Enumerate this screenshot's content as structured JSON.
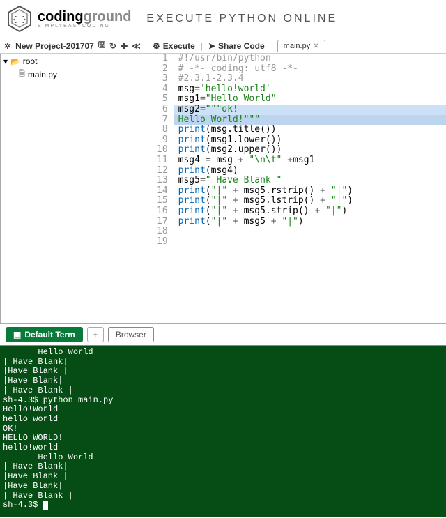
{
  "header": {
    "brand_main_a": "coding",
    "brand_main_b": "ground",
    "brand_sub": "SIMPLYEASYCODING",
    "title": "EXECUTE PYTHON ONLINE"
  },
  "project_toolbar": {
    "name": "New Project-201707"
  },
  "tree": {
    "root": "root",
    "file": "main.py"
  },
  "editor": {
    "execute": "Execute",
    "share": "Share Code",
    "tab": "main.py",
    "lines": [
      {
        "n": "1",
        "seg": [
          {
            "cls": "c-com",
            "t": "#!/usr/bin/python"
          }
        ]
      },
      {
        "n": "2",
        "seg": [
          {
            "cls": "c-com",
            "t": "# -*- coding: utf8 -*-"
          }
        ]
      },
      {
        "n": "3",
        "seg": [
          {
            "cls": "c-com",
            "t": "#2.3.1-2.3.4"
          }
        ]
      },
      {
        "n": "4",
        "seg": [
          {
            "cls": "",
            "t": "msg"
          },
          {
            "cls": "c-op",
            "t": "="
          },
          {
            "cls": "c-str",
            "t": "'hello!world'"
          }
        ]
      },
      {
        "n": "5",
        "seg": [
          {
            "cls": "",
            "t": "msg1"
          },
          {
            "cls": "c-op",
            "t": "="
          },
          {
            "cls": "c-str",
            "t": "\"Hello World\""
          }
        ]
      },
      {
        "n": "6",
        "hl": "hl",
        "seg": [
          {
            "cls": "",
            "t": "msg2"
          },
          {
            "cls": "c-op",
            "t": "="
          },
          {
            "cls": "c-str",
            "t": "\"\"\"ok!"
          }
        ]
      },
      {
        "n": "7",
        "hl": "hl-strong",
        "seg": [
          {
            "cls": "c-str",
            "t": "Hello World!\"\"\""
          }
        ]
      },
      {
        "n": "8",
        "seg": [
          {
            "cls": "",
            "t": ""
          }
        ]
      },
      {
        "n": "9",
        "seg": [
          {
            "cls": "c-fn",
            "t": "print"
          },
          {
            "cls": "",
            "t": "(msg.title())"
          }
        ]
      },
      {
        "n": "10",
        "seg": [
          {
            "cls": "c-fn",
            "t": "print"
          },
          {
            "cls": "",
            "t": "(msg1.lower())"
          }
        ]
      },
      {
        "n": "11",
        "seg": [
          {
            "cls": "c-fn",
            "t": "print"
          },
          {
            "cls": "",
            "t": "(msg2.upper())"
          }
        ]
      },
      {
        "n": "12",
        "seg": [
          {
            "cls": "",
            "t": "msg4 "
          },
          {
            "cls": "c-op",
            "t": "="
          },
          {
            "cls": "",
            "t": " msg "
          },
          {
            "cls": "c-op",
            "t": "+"
          },
          {
            "cls": "",
            "t": " "
          },
          {
            "cls": "c-str",
            "t": "\"\\n\\t\""
          },
          {
            "cls": "",
            "t": " "
          },
          {
            "cls": "c-op",
            "t": "+"
          },
          {
            "cls": "",
            "t": "msg1"
          }
        ]
      },
      {
        "n": "13",
        "seg": [
          {
            "cls": "c-fn",
            "t": "print"
          },
          {
            "cls": "",
            "t": "(msg4)"
          }
        ]
      },
      {
        "n": "14",
        "seg": [
          {
            "cls": "",
            "t": "msg5"
          },
          {
            "cls": "c-op",
            "t": "="
          },
          {
            "cls": "c-str",
            "t": "\" Have Blank \""
          }
        ]
      },
      {
        "n": "15",
        "seg": [
          {
            "cls": "c-fn",
            "t": "print"
          },
          {
            "cls": "",
            "t": "("
          },
          {
            "cls": "c-str",
            "t": "\"|\""
          },
          {
            "cls": "",
            "t": " "
          },
          {
            "cls": "c-op",
            "t": "+"
          },
          {
            "cls": "",
            "t": " msg5.rstrip() "
          },
          {
            "cls": "c-op",
            "t": "+"
          },
          {
            "cls": "",
            "t": " "
          },
          {
            "cls": "c-str",
            "t": "\"|\""
          },
          {
            "cls": "",
            "t": ")"
          }
        ]
      },
      {
        "n": "16",
        "seg": [
          {
            "cls": "c-fn",
            "t": "print"
          },
          {
            "cls": "",
            "t": "("
          },
          {
            "cls": "c-str",
            "t": "\"|\""
          },
          {
            "cls": "",
            "t": " "
          },
          {
            "cls": "c-op",
            "t": "+"
          },
          {
            "cls": "",
            "t": " msg5.lstrip() "
          },
          {
            "cls": "c-op",
            "t": "+"
          },
          {
            "cls": "",
            "t": " "
          },
          {
            "cls": "c-str",
            "t": "\"|\""
          },
          {
            "cls": "",
            "t": ")"
          }
        ]
      },
      {
        "n": "17",
        "seg": [
          {
            "cls": "c-fn",
            "t": "print"
          },
          {
            "cls": "",
            "t": "("
          },
          {
            "cls": "c-str",
            "t": "\"|\""
          },
          {
            "cls": "",
            "t": " "
          },
          {
            "cls": "c-op",
            "t": "+"
          },
          {
            "cls": "",
            "t": " msg5.strip() "
          },
          {
            "cls": "c-op",
            "t": "+"
          },
          {
            "cls": "",
            "t": " "
          },
          {
            "cls": "c-str",
            "t": "\"|\""
          },
          {
            "cls": "",
            "t": ")"
          }
        ]
      },
      {
        "n": "18",
        "seg": [
          {
            "cls": "c-fn",
            "t": "print"
          },
          {
            "cls": "",
            "t": "("
          },
          {
            "cls": "c-str",
            "t": "\"|\""
          },
          {
            "cls": "",
            "t": " "
          },
          {
            "cls": "c-op",
            "t": "+"
          },
          {
            "cls": "",
            "t": " msg5 "
          },
          {
            "cls": "c-op",
            "t": "+"
          },
          {
            "cls": "",
            "t": " "
          },
          {
            "cls": "c-str",
            "t": "\"|\""
          },
          {
            "cls": "",
            "t": ")"
          }
        ]
      },
      {
        "n": "19",
        "seg": [
          {
            "cls": "",
            "t": ""
          }
        ]
      }
    ]
  },
  "term_tabs": {
    "default": "Default Term",
    "add": "+",
    "browser": "Browser"
  },
  "terminal_lines": [
    "       Hello World",
    "| Have Blank|",
    "|Have Blank |",
    "|Have Blank|",
    "| Have Blank |",
    "sh-4.3$ python main.py",
    "Hello!World",
    "hello world",
    "OK!",
    "HELLO WORLD!",
    "hello!world",
    "       Hello World",
    "| Have Blank|",
    "|Have Blank |",
    "|Have Blank|",
    "| Have Blank |",
    "sh-4.3$ "
  ]
}
